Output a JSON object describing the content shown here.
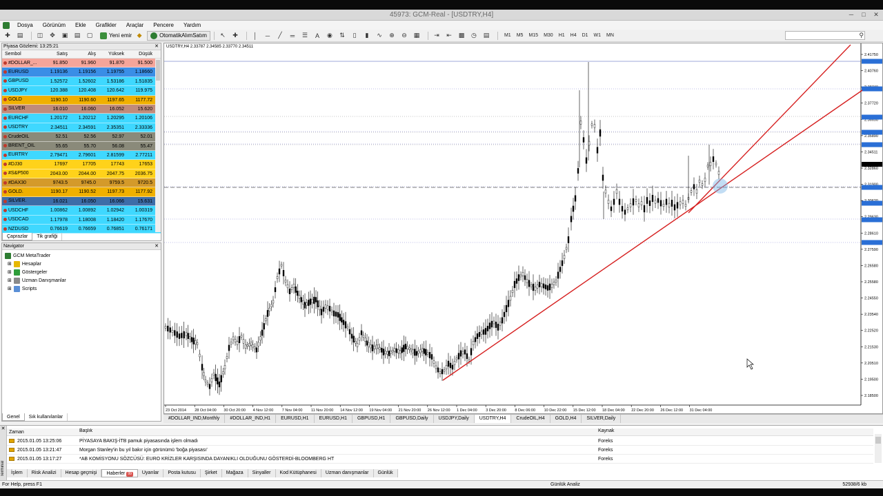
{
  "window": {
    "title": "45973: GCM-Real - [USDTRY,H4]"
  },
  "menu": [
    "Dosya",
    "Görünüm",
    "Ekle",
    "Grafikler",
    "Araçlar",
    "Pencere",
    "Yardım"
  ],
  "toolbar": {
    "new_order": "Yeni emir",
    "auto_trading": "OtomatikAlımSatım",
    "timeframes": [
      "M1",
      "M5",
      "M15",
      "M30",
      "H1",
      "H4",
      "D1",
      "W1",
      "MN"
    ]
  },
  "market_watch": {
    "title": "Piyasa Gözlemi: 13:25:21",
    "columns": [
      "Sembol",
      "Satış",
      "Alış",
      "Yüksek",
      "Düşük"
    ],
    "rows": [
      {
        "symbol": "#DOLLAR_...",
        "bid": "91.850",
        "ask": "91.960",
        "high": "91.870",
        "low": "91.500",
        "color": "#f5a59a"
      },
      {
        "symbol": "EURUSD",
        "bid": "1.19136",
        "ask": "1.19156",
        "high": "1.19755",
        "low": "1.18660",
        "color": "#3a8ee6"
      },
      {
        "symbol": "GBPUSD",
        "bid": "1.52572",
        "ask": "1.52602",
        "high": "1.53186",
        "low": "1.51835",
        "color": "#3fd8ff"
      },
      {
        "symbol": "USDJPY",
        "bid": "120.388",
        "ask": "120.408",
        "high": "120.642",
        "low": "119.975",
        "color": "#3fd8ff"
      },
      {
        "symbol": "GOLD",
        "bid": "1190.10",
        "ask": "1190.60",
        "high": "1197.65",
        "low": "1177.72",
        "color": "#f0b000"
      },
      {
        "symbol": "SILVER",
        "bid": "16.010",
        "ask": "16.060",
        "high": "16.052",
        "low": "15.620",
        "color": "#c08b7a"
      },
      {
        "symbol": "EURCHF",
        "bid": "1.20172",
        "ask": "1.20212",
        "high": "1.20295",
        "low": "1.20106",
        "color": "#3fd8ff"
      },
      {
        "symbol": "USDTRY",
        "bid": "2.34511",
        "ask": "2.34591",
        "high": "2.35351",
        "low": "2.33336",
        "color": "#3fd8ff"
      },
      {
        "symbol": "CrudeOIL",
        "bid": "52.51",
        "ask": "52.56",
        "high": "52.97",
        "low": "52.01",
        "color": "#8a8a7a"
      },
      {
        "symbol": "BRENT_OIL",
        "bid": "55.65",
        "ask": "55.70",
        "high": "56.08",
        "low": "55.47",
        "color": "#8a8a7a"
      },
      {
        "symbol": "EURTRY",
        "bid": "2.79471",
        "ask": "2.79601",
        "high": "2.81599",
        "low": "2.77211",
        "color": "#3fd8ff"
      },
      {
        "symbol": "#DJ30",
        "bid": "17697",
        "ask": "17705",
        "high": "17743",
        "low": "17653",
        "color": "#ffd21a"
      },
      {
        "symbol": "#S&P500",
        "bid": "2043.00",
        "ask": "2044.00",
        "high": "2047.75",
        "low": "2036.75",
        "color": "#ffd21a"
      },
      {
        "symbol": "#DAX30",
        "bid": "9743.5",
        "ask": "9745.0",
        "high": "9759.5",
        "low": "9720.5",
        "color": "#d49a2a"
      },
      {
        "symbol": "GOLD.",
        "bid": "1190.17",
        "ask": "1190.52",
        "high": "1197.73",
        "low": "1177.92",
        "color": "#f0b000"
      },
      {
        "symbol": "SILVER.",
        "bid": "16.021",
        "ask": "16.050",
        "high": "16.066",
        "low": "15.631",
        "color": "#3d6da8"
      },
      {
        "symbol": "USDCHF",
        "bid": "1.00862",
        "ask": "1.00892",
        "high": "1.02942",
        "low": "1.00319",
        "color": "#3fd8ff"
      },
      {
        "symbol": "USDCAD",
        "bid": "1.17978",
        "ask": "1.18008",
        "high": "1.18420",
        "low": "1.17670",
        "color": "#3fd8ff"
      },
      {
        "symbol": "NZDUSD",
        "bid": "0.76619",
        "ask": "0.76659",
        "high": "0.76851",
        "low": "0.76171",
        "color": "#3fd8ff"
      }
    ],
    "tabs": [
      "Çaprazlar",
      "Tik grafiği"
    ]
  },
  "navigator": {
    "title": "Navigator",
    "root": "GCM MetaTrader",
    "items": [
      "Hesaplar",
      "Göstergeler",
      "Uzman Danışmanlar",
      "Scripts"
    ],
    "tabs": [
      "Genel",
      "Sık kullanılanlar"
    ]
  },
  "chart": {
    "header": "USDTRY,H4  2.33787 2.34585 2.33770 2.34511",
    "price_labels": [
      "2.41750",
      "2.40760",
      "2.38740",
      "2.37720",
      "2.36650",
      "2.35890",
      "2.34511",
      "2.32860",
      "2.31900",
      "2.30620",
      "2.29630",
      "2.28610",
      "2.27590",
      "2.26580",
      "2.25580",
      "2.24550",
      "2.23540",
      "2.22520",
      "2.21530",
      "2.20510",
      "2.19500",
      "2.18500"
    ],
    "date_labels": [
      "23 Oct 2014",
      "28 Oct 04:00",
      "30 Oct 20:00",
      "4 Nov 12:00",
      "7 Nov 04:00",
      "11 Nov 20:00",
      "14 Nov 12:00",
      "19 Nov 04:00",
      "21 Nov 20:00",
      "26 Nov 12:00",
      "1 Dec 04:00",
      "3 Dec 20:00",
      "8 Dec 06:00",
      "10 Dec 22:00",
      "15 Dec 12:00",
      "18 Dec 04:00",
      "22 Dec 20:00",
      "26 Dec 12:00",
      "31 Dec 04:00"
    ],
    "tabs": [
      "#DOLLAR_IND,Monthly",
      "#DOLLAR_IND,H1",
      "EURUSD,H1",
      "EURUSD,H1",
      "GBPUSD,H1",
      "GBPUSD,Daily",
      "USDJPY,Daily",
      "USDTRY,H4",
      "CrudeOIL,H4",
      "GOLD,H4",
      "SILVER,Daily"
    ],
    "active_tab": 7
  },
  "terminal": {
    "label": "Terminal",
    "columns": [
      "Zaman",
      "Başlık",
      "Kaynak"
    ],
    "news": [
      {
        "time": "2015.01.05 13:25:06",
        "title": "PİYASAYA BAKIŞ-İTB pamuk piyasasında işlem olmadı",
        "source": "Foreks"
      },
      {
        "time": "2015.01.05 13:21:47",
        "title": "Morgan Stanley'in bu yıl bakır için görünümü 'boğa piyasası'",
        "source": "Foreks"
      },
      {
        "time": "2015.01.05 13:17:27",
        "title": "*AB KOMİSYONU SÖZCÜSÜ: EURO KRİZLER KARŞISINDA DAYANIKLI OLDUĞUNU GÖSTERDİ-BLOOMBERG HT",
        "source": "Foreks"
      }
    ],
    "tabs": [
      "İşlem",
      "Risk Analizi",
      "Hesap geçmişi",
      "Haberler",
      "Uyarılar",
      "Posta kutusu",
      "Şirket",
      "Mağaza",
      "Sinyaller",
      "Kod Kütüphanesi",
      "Uzman danışmanlar",
      "Günlük"
    ],
    "active_tab": 3,
    "news_badge": "99"
  },
  "status": {
    "help": "For Help, press F1",
    "profile": "Günlük Analiz",
    "traffic": "52938/6 kb"
  },
  "colors": {
    "trendline": "#d62020",
    "candle": "#000000"
  }
}
